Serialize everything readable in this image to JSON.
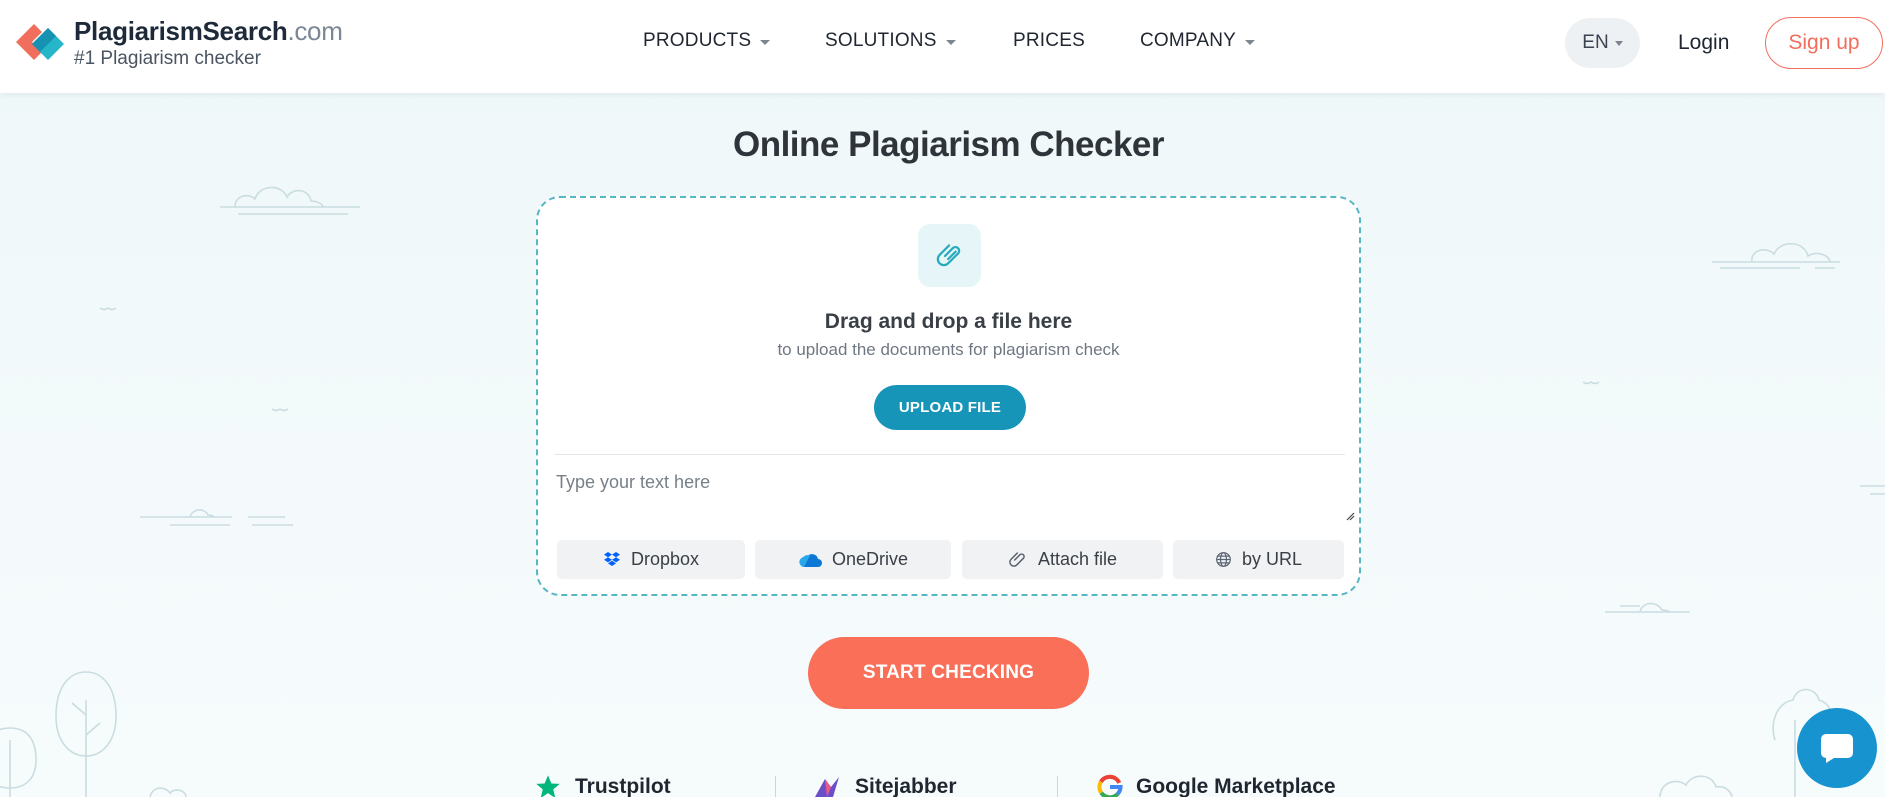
{
  "header": {
    "logo_name": "PlagiarismSearch",
    "logo_domain": ".com",
    "logo_tagline": "#1 Plagiarism checker",
    "nav": [
      {
        "label": "PRODUCTS",
        "dropdown": true
      },
      {
        "label": "SOLUTIONS",
        "dropdown": true
      },
      {
        "label": "PRICES",
        "dropdown": false
      },
      {
        "label": "COMPANY",
        "dropdown": true
      }
    ],
    "language": "EN",
    "login": "Login",
    "signup": "Sign up"
  },
  "main": {
    "title": "Online Plagiarism Checker",
    "upload": {
      "drag_title": "Drag and drop a file here",
      "drag_subtitle": "to upload the documents for plagiarism check",
      "upload_button": "UPLOAD FILE"
    },
    "text_input": {
      "value": "",
      "placeholder": "Type your text here"
    },
    "sources": [
      {
        "label": "Dropbox",
        "icon": "dropbox-icon"
      },
      {
        "label": "OneDrive",
        "icon": "onedrive-icon"
      },
      {
        "label": "Attach file",
        "icon": "paperclip-icon"
      },
      {
        "label": "by URL",
        "icon": "globe-icon"
      }
    ],
    "start_button": "START CHECKING"
  },
  "ratings": [
    {
      "label": "Trustpilot",
      "icon": "trustpilot-star-icon"
    },
    {
      "label": "Sitejabber",
      "icon": "sitejabber-icon"
    },
    {
      "label": "Google Marketplace",
      "icon": "google-icon"
    }
  ],
  "colors": {
    "accent": "#f96f58",
    "primary_blue": "#1795b8",
    "dashed_border": "#58b7c4",
    "chat": "#1793cf"
  }
}
